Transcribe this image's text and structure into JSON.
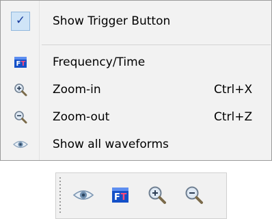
{
  "context_menu": {
    "items": [
      {
        "label": "Show Trigger Button",
        "shortcut": "",
        "icon": "checkmark-icon",
        "checked": true
      },
      {
        "label": "Frequency/Time",
        "shortcut": "",
        "icon": "frequency-time-icon"
      },
      {
        "label": "Zoom-in",
        "shortcut": "Ctrl+X",
        "icon": "zoom-in-icon"
      },
      {
        "label": "Zoom-out",
        "shortcut": "Ctrl+Z",
        "icon": "zoom-out-icon"
      },
      {
        "label": "Show all waveforms",
        "shortcut": "",
        "icon": "eye-icon"
      }
    ],
    "check_glyph": "✓"
  },
  "toolbar": {
    "buttons": [
      {
        "icon": "eye-icon"
      },
      {
        "icon": "frequency-time-icon"
      },
      {
        "icon": "zoom-in-icon"
      },
      {
        "icon": "zoom-out-icon"
      }
    ]
  },
  "colors": {
    "menu_bg": "#f2f2f2",
    "check_bg": "#cfe4f7",
    "ft_icon_blue": "#1450c8"
  }
}
